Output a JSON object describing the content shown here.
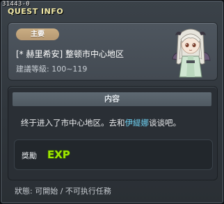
{
  "window": {
    "quest_id": "31443-0",
    "title": "QUEST INFO"
  },
  "header": {
    "category": "主要",
    "quest_name": "[* 赫里希安] 整顿市中心地区",
    "level_label": "建議等級: 100~119",
    "npc_portrait": "white-haired-npc-portrait"
  },
  "content": {
    "section_title": "内容",
    "text_before": "终于进入了市中心地区。去和",
    "npc_name": "伊緹娜",
    "text_after": "谈谈吧。",
    "reward_label": "獎勵",
    "reward_icon": "exp-icon",
    "reward_icon_text": "EXP"
  },
  "footer": {
    "status": "狀態:  可開始 / 不可执行任務"
  },
  "colors": {
    "title": "#f2e9a6",
    "badge": "#c9ad83",
    "npc_link": "#6fd2f3",
    "exp": "#9fe600"
  }
}
